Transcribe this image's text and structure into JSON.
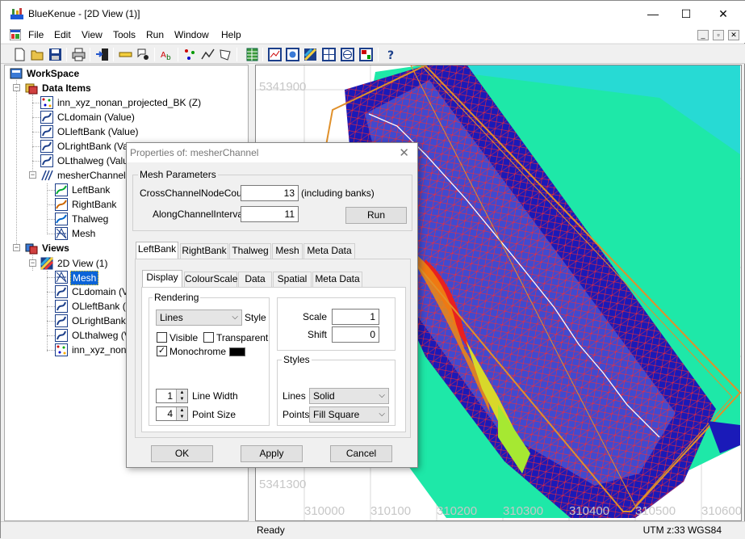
{
  "app": {
    "title": "BlueKenue - [2D View (1)]",
    "controls": {
      "minimize": "—",
      "maximize": "☐",
      "close": "✕"
    }
  },
  "menu": {
    "items": [
      "File",
      "Edit",
      "View",
      "Tools",
      "Run",
      "Window",
      "Help"
    ],
    "mdi_controls": [
      "_",
      "▫",
      "✕"
    ]
  },
  "tree": {
    "root": "WorkSpace",
    "data_items": "Data Items",
    "items": [
      "inn_xyz_nonan_projected_BK (Z)",
      "CLdomain (Value)",
      "OLleftBank (Value)",
      "OLrightBank (Value)",
      "OLthalweg (Value)",
      "mesherChannel",
      "LeftBank",
      "RightBank",
      "Thalweg",
      "Mesh"
    ],
    "views": "Views",
    "view_items": [
      "2D View (1)",
      "Mesh",
      "CLdomain (V",
      "OLleftBank (V",
      "OLrightBank (",
      "OLthalweg (V",
      "inn_xyz_nonan"
    ]
  },
  "view": {
    "y_labels": [
      "5341900",
      "5341300"
    ],
    "x_labels": [
      "310000",
      "310100",
      "310200",
      "310300",
      "310400",
      "310500",
      "310600"
    ]
  },
  "status": {
    "left": "Ready",
    "right": "UTM z:33 WGS84"
  },
  "dialog": {
    "title": "Properties of: mesherChannel",
    "mesh_params_label": "Mesh Parameters",
    "cross_label": "CrossChannelNodeCount",
    "cross_value": "13",
    "cross_note": "(including banks)",
    "along_label": "AlongChannelInterval",
    "along_value": "11",
    "run_button": "Run",
    "outer_tabs": [
      "LeftBank",
      "RightBank",
      "Thalweg",
      "Mesh",
      "Meta Data"
    ],
    "inner_tabs": [
      "Display",
      "ColourScale",
      "Data",
      "Spatial",
      "Meta Data"
    ],
    "rendering_label": "Rendering",
    "style_value": "Lines",
    "style_label": "Style",
    "visible_label": "Visible",
    "transparent_label": "Transparent",
    "monochrome_label": "Monochrome",
    "line_width_value": "1",
    "line_width_label": "Line Width",
    "point_size_value": "4",
    "point_size_label": "Point Size",
    "scale_label": "Scale",
    "scale_value": "1",
    "shift_label": "Shift",
    "shift_value": "0",
    "styles_label": "Styles",
    "lines_label": "Lines",
    "lines_value": "Solid",
    "points_label": "Points",
    "points_value": "Fill Square",
    "ok_button": "OK",
    "apply_button": "Apply",
    "cancel_button": "Cancel",
    "monochrome_checked": true,
    "visible_checked": false,
    "transparent_checked": false
  },
  "colors": {
    "mesh_line": "#ff2a2a",
    "selection": "#0a64d8",
    "channel_dark": "#1a1ab8",
    "floodplain": "#1ee8a8"
  }
}
